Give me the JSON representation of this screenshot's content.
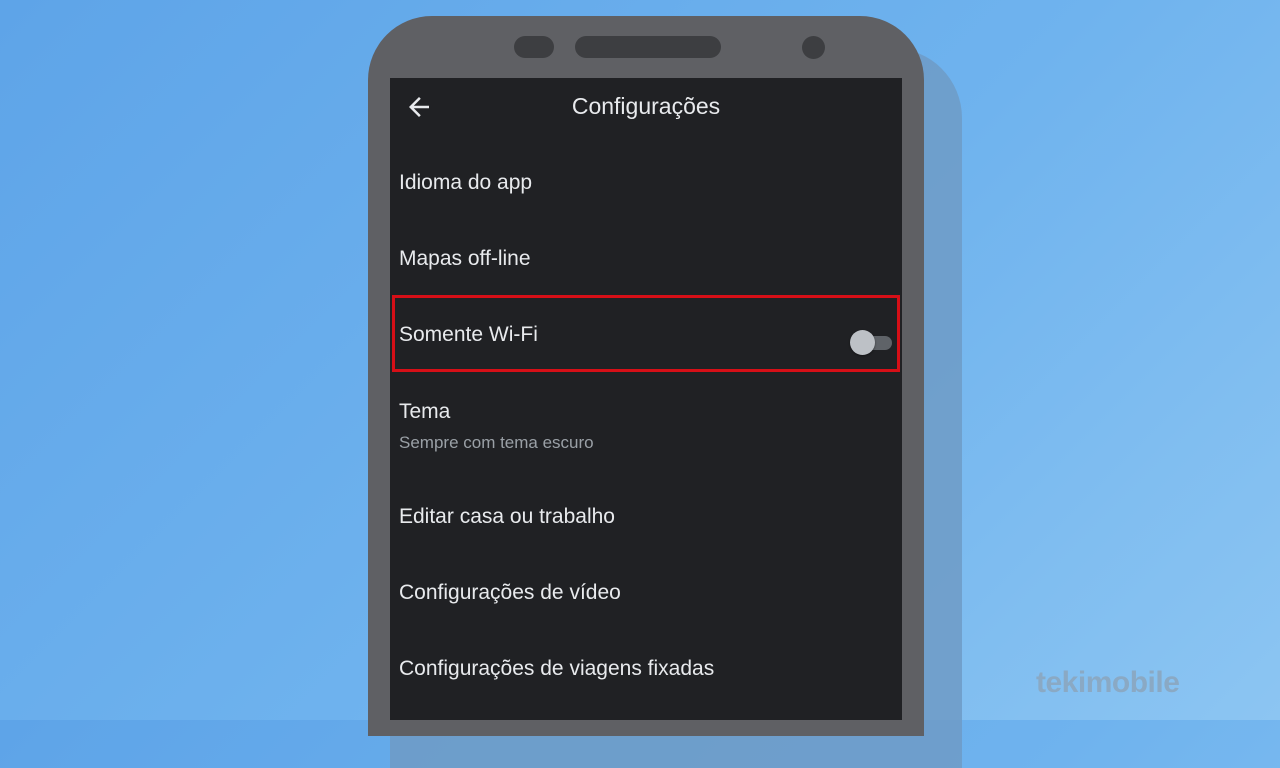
{
  "header": {
    "title": "Configurações"
  },
  "settings": {
    "items": [
      {
        "label": "Idioma do app"
      },
      {
        "label": "Mapas off-line"
      },
      {
        "label": "Somente Wi-Fi",
        "toggle_on": false
      },
      {
        "label": "Tema",
        "sublabel": "Sempre com tema escuro"
      },
      {
        "label": "Editar casa ou trabalho"
      },
      {
        "label": "Configurações de vídeo"
      },
      {
        "label": "Configurações de viagens fixadas"
      }
    ]
  },
  "watermark": {
    "text": "tekimobile"
  },
  "colors": {
    "background": "#6fb3ee",
    "screen": "#202124",
    "highlight_border": "#d60f17"
  },
  "icons": {
    "back": "arrow-left-icon"
  }
}
